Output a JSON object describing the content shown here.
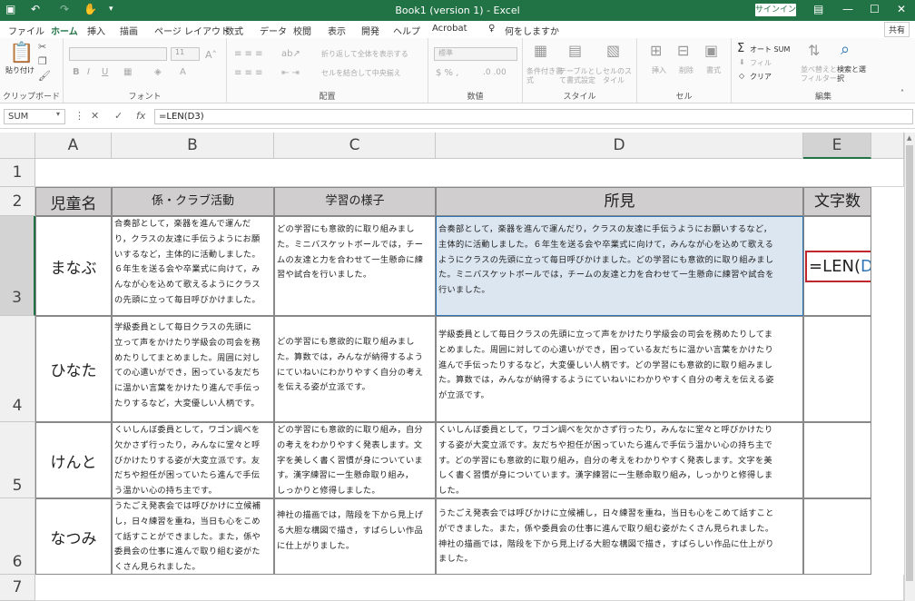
{
  "titlebar": {
    "title": "Book1 (version 1) - Excel",
    "signin": "サインイン"
  },
  "tabs": [
    "ファイル",
    "ホーム",
    "挿入",
    "描画",
    "ページ レイアウト",
    "数式",
    "データ",
    "校閲",
    "表示",
    "開発",
    "ヘルプ",
    "Acrobat",
    "何をしますか"
  ],
  "share": "共有",
  "ribbon": {
    "clipboard": "クリップボード",
    "paste": "貼り付け",
    "font": "フォント",
    "font_size": "11",
    "align": "配置",
    "wrap": "折り返して全体を表示する",
    "merge": "セルを結合して中央揃え",
    "number": "数値",
    "number_fmt": "標準",
    "style": "スタイル",
    "cond": "条件付き書式",
    "table": "テーブルとして書式設定",
    "cellstyle": "セルのスタイル",
    "cells": "セル",
    "insert": "挿入",
    "delete": "削除",
    "format": "書式",
    "editing": "編集",
    "autosum": "オート SUM",
    "fill": "フィル",
    "clear": "クリア",
    "sort": "並べ替えとフィルター",
    "find": "検索と選択"
  },
  "formula_bar": {
    "name_box": "SUM",
    "formula": "=LEN(D3)",
    "fx": "fx"
  },
  "columns": [
    "A",
    "B",
    "C",
    "D",
    "E"
  ],
  "rows": [
    "1",
    "2",
    "3",
    "4",
    "5",
    "6",
    "7"
  ],
  "header": {
    "a": "児童名",
    "b": "係・クラブ活動",
    "c": "学習の様子",
    "d": "所見",
    "e": "文字数"
  },
  "data": [
    {
      "name": "まなぶ",
      "b": [
        "合奏部として，楽器を進んで運んだ",
        "り，クラスの友達に手伝うようにお願",
        "いするなど，主体的に活動しました。",
        "６年生を送る会や卒業式に向けて，み",
        "んなが心を込めて歌えるようにクラス",
        "の先頭に立って毎日呼びかけました。"
      ],
      "c": [
        "",
        "どの学習にも意欲的に取り組みまし",
        "た。ミニバスケットボールでは，チー",
        "ムの友達と力を合わせて一生懸命に練",
        "習や試合を行いました。"
      ],
      "d": [
        "合奏部として，楽器を進んで運んだり，クラスの友達に手伝うようにお願いするなど，",
        "主体的に活動しました。６年生を送る会や卒業式に向けて，みんなが心を込めて歌える",
        "ようにクラスの先頭に立って毎日呼びかけました。どの学習にも意欲的に取り組みまし",
        "た。ミニバスケットボールでは，チームの友達と力を合わせて一生懸命に練習や試合を",
        "行いました。"
      ],
      "e_pre": "=LEN(",
      "e_ref": "D3",
      "e_post": ")"
    },
    {
      "name": "ひなた",
      "b": [
        "学級委員として毎日クラスの先頭に",
        "立って声をかけたり学級会の司会を務",
        "めたりしてまとめました。周囲に対し",
        "ての心遣いができ，困っている友だち",
        "に温かい言葉をかけたり進んで手伝っ",
        "たりするなど，大変優しい人柄です。"
      ],
      "c": [
        "",
        "どの学習にも意欲的に取り組みまし",
        "た。算数では，みんなが納得するよう",
        "にていねいにわかりやすく自分の考え",
        "を伝える姿が立派です。"
      ],
      "d": [
        "",
        "学級委員として毎日クラスの先頭に立って声をかけたり学級会の司会を務めたりしてま",
        "とめました。周囲に対しての心遣いができ，困っている友だちに温かい言葉をかけたり",
        "進んで手伝ったりするなど，大変優しい人柄です。どの学習にも意欲的に取り組みまし",
        "た。算数では，みんなが納得するようにていねいにわかりやすく自分の考えを伝える姿",
        "が立派です。"
      ]
    },
    {
      "name": "けんと",
      "b": [
        "くいしんぼ委員として，ワゴン調べを",
        "欠かさず行ったり，みんなに堂々と呼",
        "びかけたりする姿が大変立派です。友",
        "だちや担任が困っていたら進んで手伝",
        "う温かい心の持ち主です。"
      ],
      "c": [
        "どの学習にも意欲的に取り組み，自分",
        "の考えをわかりやすく発表します。文",
        "字を美しく書く習慣が身についていま",
        "す。漢字練習に一生懸命取り組み，",
        "しっかりと修得しました。"
      ],
      "d": [
        "くいしんぼ委員として，ワゴン調べを欠かさず行ったり，みんなに堂々と呼びかけたり",
        "する姿が大変立派です。友だちや担任が困っていたら進んで手伝う温かい心の持ち主で",
        "す。どの学習にも意欲的に取り組み，自分の考えをわかりやすく発表します。文字を美",
        "しく書く習慣が身についています。漢字練習に一生懸命取り組み，しっかりと修得しま",
        "した。"
      ]
    },
    {
      "name": "なつみ",
      "b": [
        "うたごえ発表会では呼びかけに立候補",
        "し，日々練習を重ね，当日も心をこめ",
        "て話すことができました。また，係や",
        "委員会の仕事に進んで取り組む姿がた",
        "くさん見られました。"
      ],
      "c": [
        "",
        "神社の描画では，階段を下から見上げ",
        "る大胆な構図で描き，すばらしい作品",
        "に仕上がりました。"
      ],
      "d": [
        "",
        "うたごえ発表会では呼びかけに立候補し，日々練習を重ね，当日も心をこめて話すこと",
        "ができました。また，係や委員会の仕事に進んで取り組む姿がたくさん見られました。",
        "神社の描画では，階段を下から見上げる大胆な構図で描き，すばらしい作品に仕上がり",
        "ました。"
      ]
    }
  ],
  "colors": {
    "excel_green": "#217346",
    "selection": "#dce6f1",
    "header_fill": "#d0cece",
    "highlight_red": "#c0272d",
    "ref_blue": "#2e75b6"
  }
}
